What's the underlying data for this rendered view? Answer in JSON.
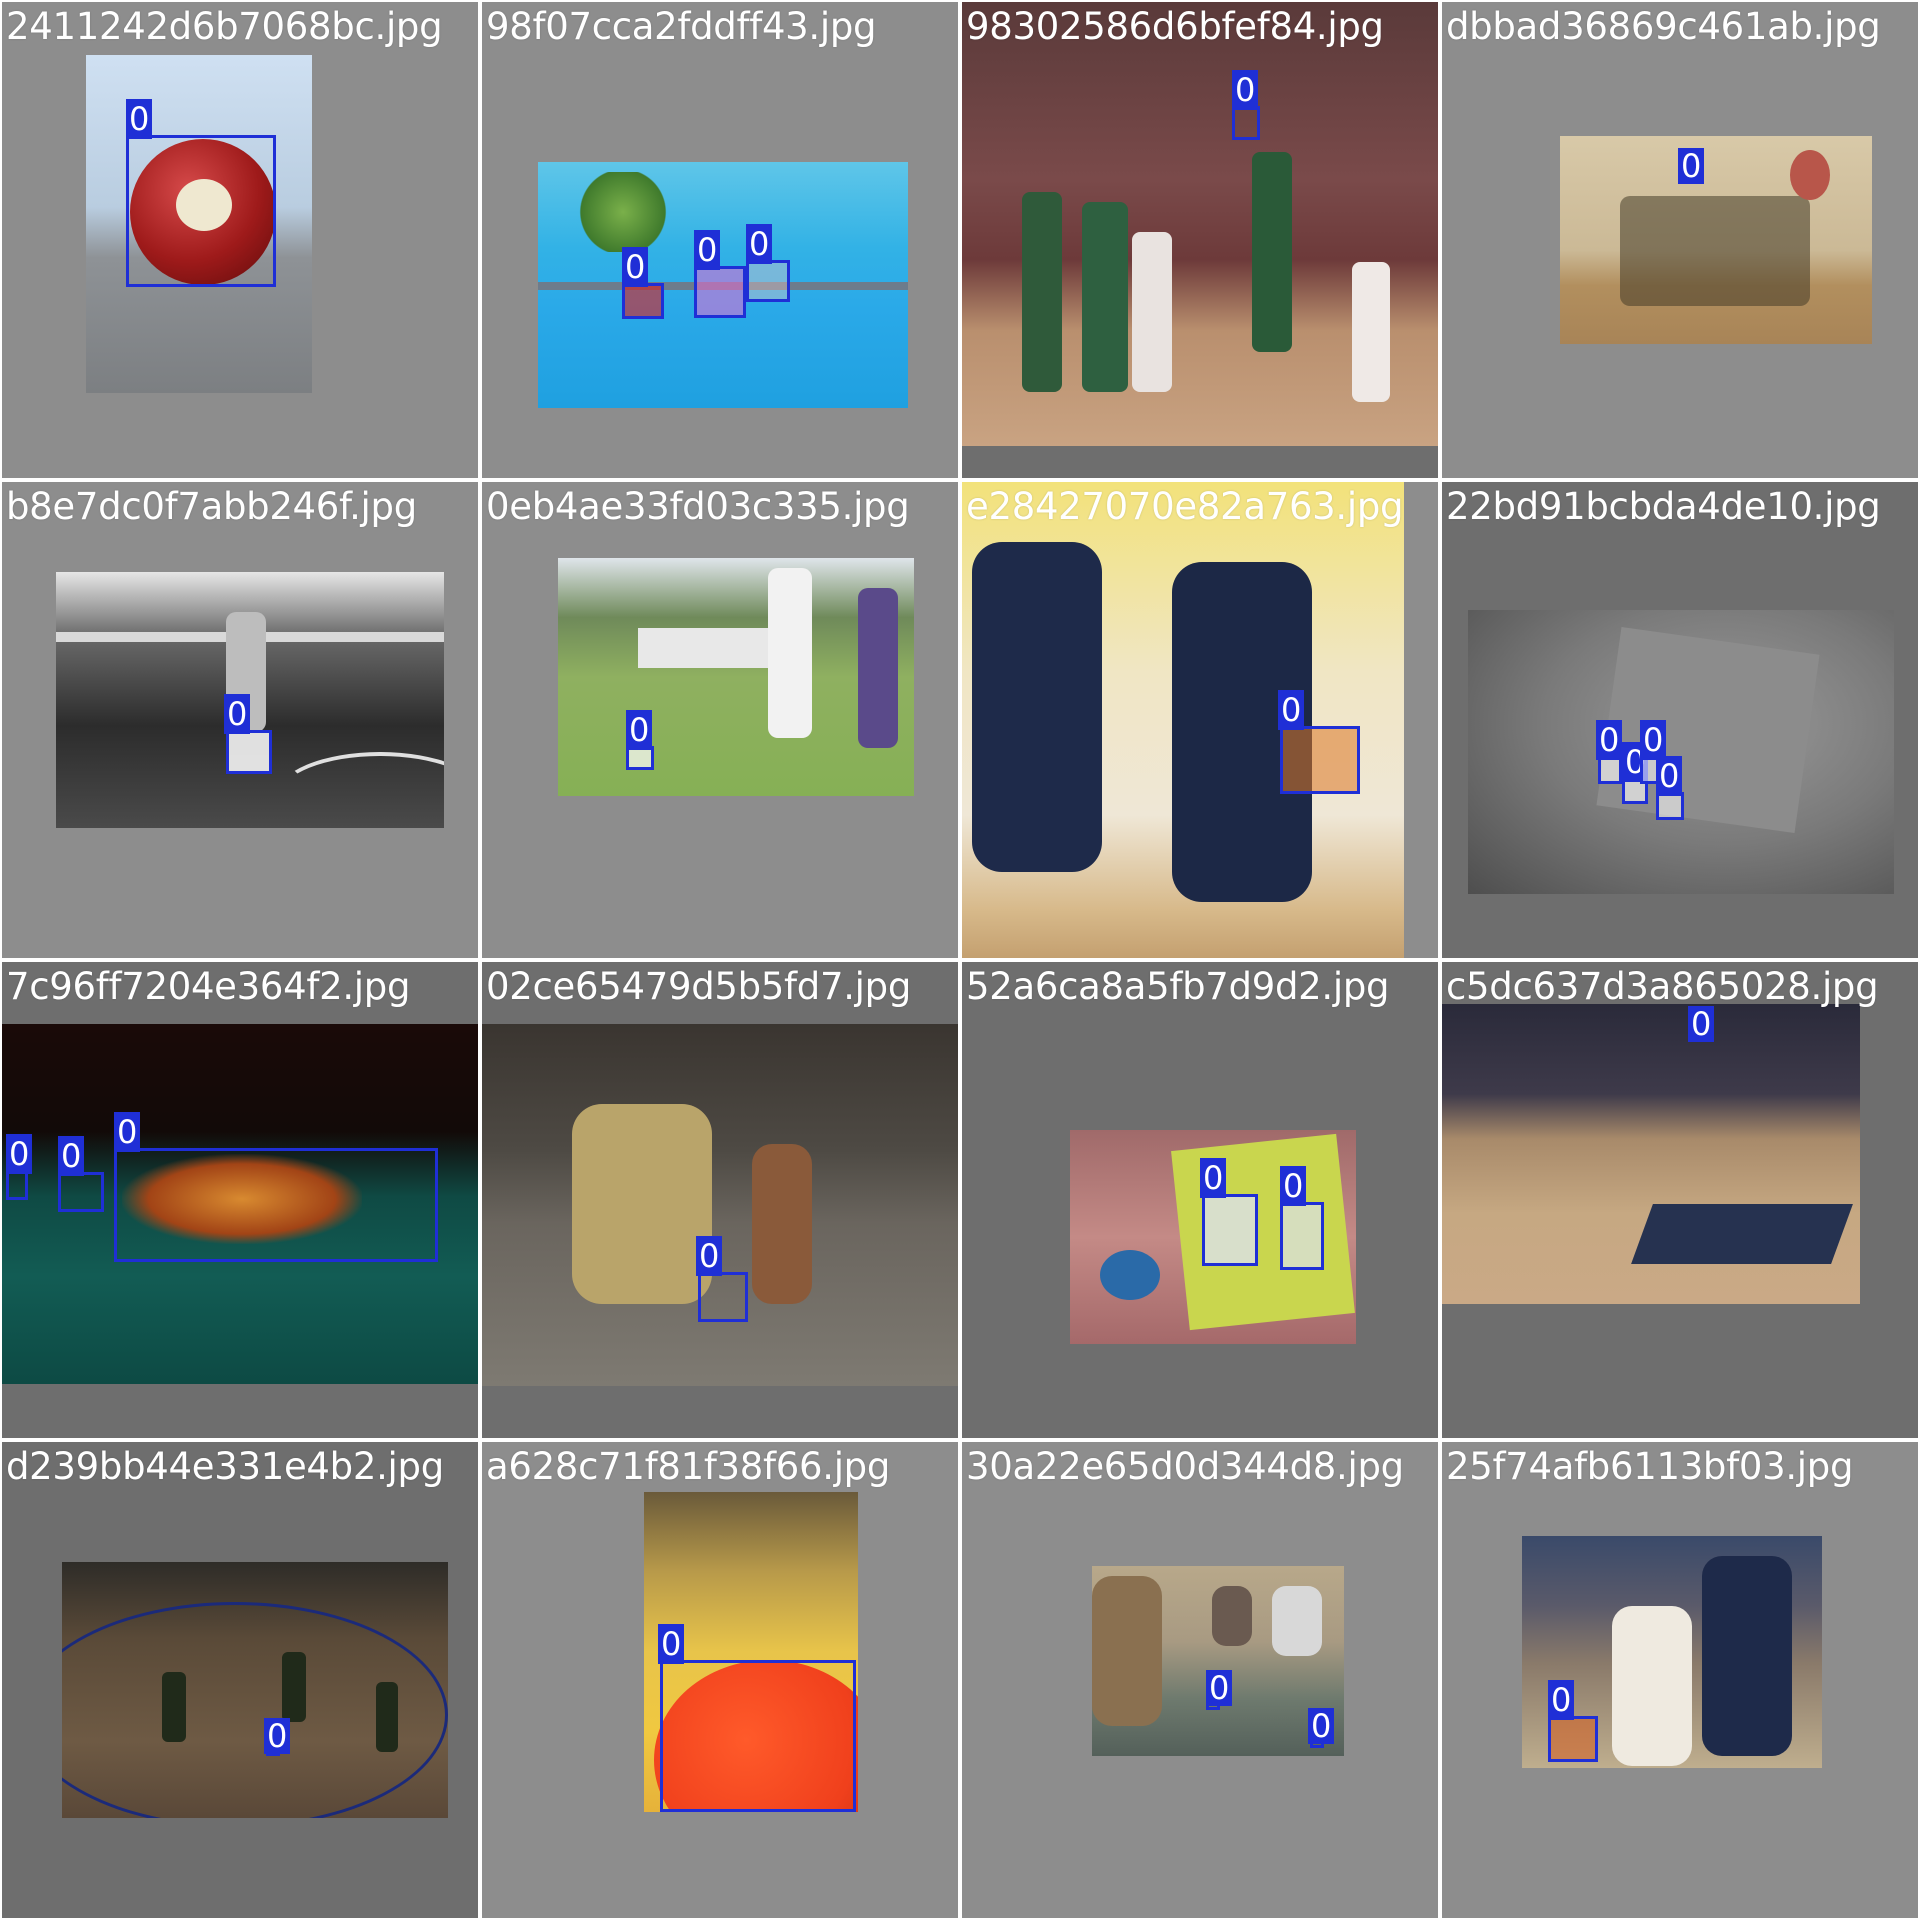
{
  "mosaic": {
    "tile_backgrounds": [
      "#8d8d8d",
      "#6e6e6e"
    ],
    "box_color": "#1f2fd6",
    "label_text_color": "#ffffff",
    "tiles": [
      {
        "filename": "2411242d6b7068bc.jpg",
        "boxes": [
          {
            "label": "0"
          }
        ]
      },
      {
        "filename": "98f07cca2fddff43.jpg",
        "boxes": [
          {
            "label": "0"
          },
          {
            "label": "0"
          },
          {
            "label": "0"
          }
        ]
      },
      {
        "filename": "98302586d6bfef84.jpg",
        "boxes": [
          {
            "label": "0"
          }
        ]
      },
      {
        "filename": "dbbad36869c461ab.jpg",
        "boxes": [
          {
            "label": "0"
          }
        ]
      },
      {
        "filename": "b8e7dc0f7abb246f.jpg",
        "boxes": [
          {
            "label": "0"
          }
        ]
      },
      {
        "filename": "0eb4ae33fd03c335.jpg",
        "boxes": [
          {
            "label": "0"
          }
        ]
      },
      {
        "filename": "e28427070e82a763.jpg",
        "boxes": [
          {
            "label": "0"
          }
        ]
      },
      {
        "filename": "22bd91bcbda4de10.jpg",
        "boxes": [
          {
            "label": "0"
          },
          {
            "label": "0"
          },
          {
            "label": "0"
          },
          {
            "label": "0"
          }
        ]
      },
      {
        "filename": "7c96ff7204e364f2.jpg",
        "boxes": [
          {
            "label": "0"
          },
          {
            "label": "0"
          },
          {
            "label": "0"
          }
        ]
      },
      {
        "filename": "02ce65479d5b5fd7.jpg",
        "boxes": [
          {
            "label": "0"
          }
        ]
      },
      {
        "filename": "52a6ca8a5fb7d9d2.jpg",
        "boxes": [
          {
            "label": "0"
          },
          {
            "label": "0"
          }
        ]
      },
      {
        "filename": "c5dc637d3a865028.jpg",
        "boxes": [
          {
            "label": "0"
          }
        ]
      },
      {
        "filename": "d239bb44e331e4b2.jpg",
        "boxes": [
          {
            "label": "0"
          }
        ]
      },
      {
        "filename": "a628c71f81f38f66.jpg",
        "boxes": [
          {
            "label": "0"
          }
        ]
      },
      {
        "filename": "30a22e65d0d344d8.jpg",
        "boxes": [
          {
            "label": "0"
          },
          {
            "label": "0"
          }
        ]
      },
      {
        "filename": "25f74afb6113bf03.jpg",
        "boxes": [
          {
            "label": "0"
          }
        ]
      }
    ]
  }
}
